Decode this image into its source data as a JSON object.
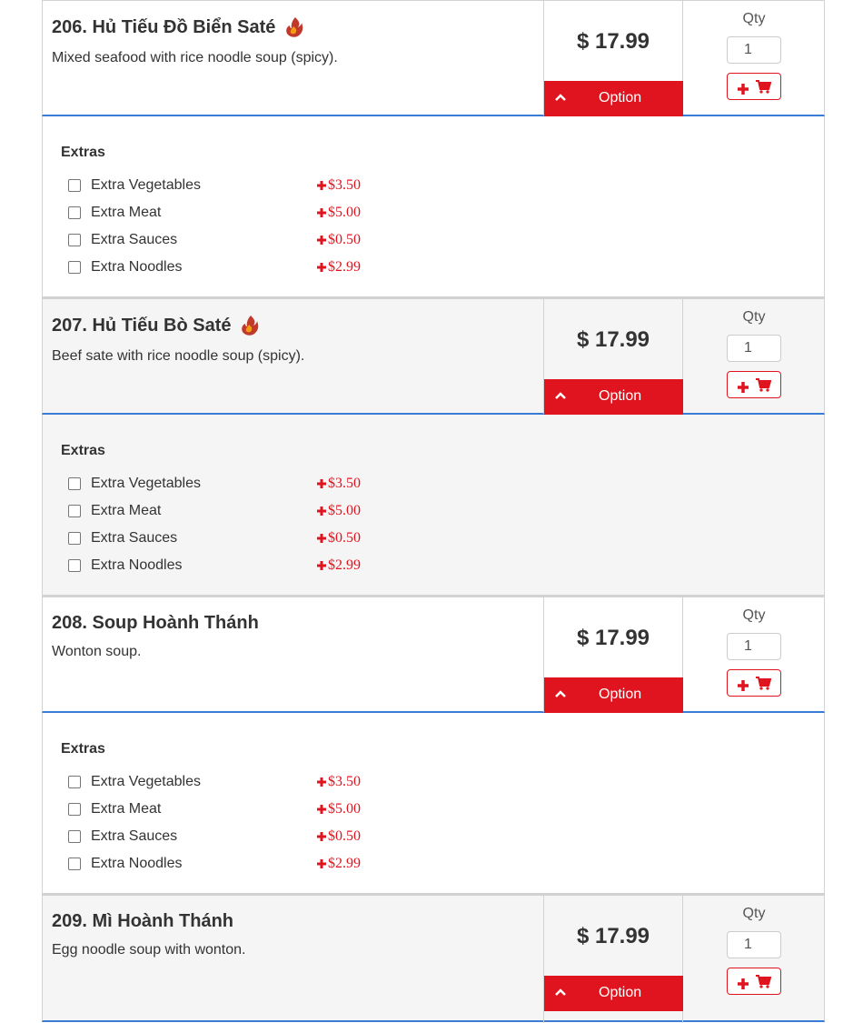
{
  "items": [
    {
      "title": "206. Hủ Tiếu Đồ Biển Saté",
      "spicy": true,
      "description": "Mixed seafood with rice noodle soup (spicy).",
      "price": "$ 17.99",
      "option_label": "Option",
      "qty_label": "Qty",
      "qty_value": "1",
      "extras_title": "Extras",
      "extras": [
        {
          "name": "Extra Vegetables",
          "price": "$3.50"
        },
        {
          "name": "Extra Meat",
          "price": "$5.00"
        },
        {
          "name": "Extra Sauces",
          "price": "$0.50"
        },
        {
          "name": "Extra Noodles",
          "price": "$2.99"
        }
      ]
    },
    {
      "title": "207. Hủ Tiếu Bò Saté",
      "spicy": true,
      "description": "Beef sate with rice noodle soup (spicy).",
      "price": "$ 17.99",
      "option_label": "Option",
      "qty_label": "Qty",
      "qty_value": "1",
      "extras_title": "Extras",
      "extras": [
        {
          "name": "Extra Vegetables",
          "price": "$3.50"
        },
        {
          "name": "Extra Meat",
          "price": "$5.00"
        },
        {
          "name": "Extra Sauces",
          "price": "$0.50"
        },
        {
          "name": "Extra Noodles",
          "price": "$2.99"
        }
      ]
    },
    {
      "title": "208. Soup Hoành Thánh",
      "spicy": false,
      "description": "Wonton soup.",
      "price": "$ 17.99",
      "option_label": "Option",
      "qty_label": "Qty",
      "qty_value": "1",
      "extras_title": "Extras",
      "extras": [
        {
          "name": "Extra Vegetables",
          "price": "$3.50"
        },
        {
          "name": "Extra Meat",
          "price": "$5.00"
        },
        {
          "name": "Extra Sauces",
          "price": "$0.50"
        },
        {
          "name": "Extra Noodles",
          "price": "$2.99"
        }
      ]
    },
    {
      "title": "209. Mì Hoành Thánh",
      "spicy": false,
      "description": "Egg noodle soup with wonton.",
      "price": "$ 17.99",
      "option_label": "Option",
      "qty_label": "Qty",
      "qty_value": "1",
      "extras_title": "Extras",
      "extras": []
    }
  ],
  "icons": {
    "spicy": "chili-flame-icon",
    "option": "chevron-up-icon",
    "add": "plus-icon",
    "cart": "shopping-cart-icon"
  },
  "colors": {
    "accent_red": "#e0141e",
    "divider_blue": "#3a7bd5",
    "row_alt_bg": "#f5f5f5",
    "border_gray": "#d2d2d2"
  }
}
